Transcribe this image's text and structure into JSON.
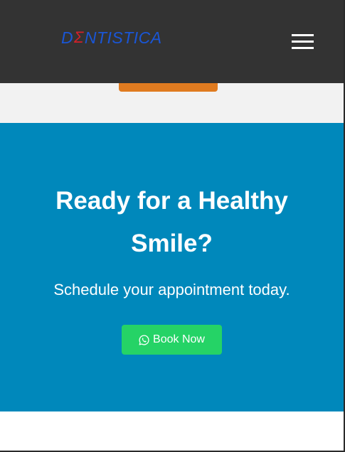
{
  "header": {
    "logo": {
      "first_letter": "D",
      "sigma_letter": "Σ",
      "rest": "NTISTICA"
    },
    "menu_icon": "hamburger-menu-icon",
    "background_color": "#333333"
  },
  "cta": {
    "title": "Ready for a Healthy Smile?",
    "subtitle": "Schedule your appointment today.",
    "button": {
      "icon": "whatsapp-icon",
      "label": "Book Now",
      "color": "#25d366"
    },
    "background_color": "#0088bb"
  },
  "colors": {
    "orange_button": "#e07b20",
    "logo_blue": "#1a56d6",
    "logo_red": "#d4202a",
    "gray_band": "#f2f2f2"
  }
}
